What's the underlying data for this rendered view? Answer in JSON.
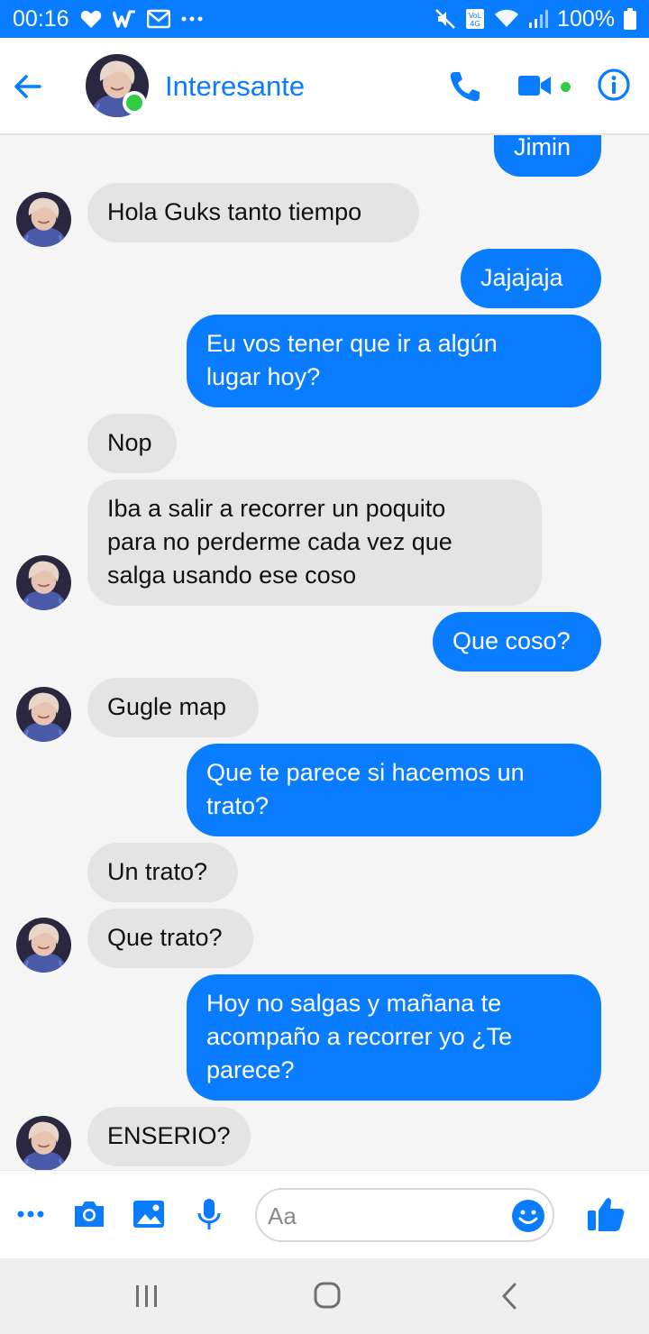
{
  "status_bar": {
    "time": "00:16",
    "battery": "100%",
    "left_icons": [
      "heart-icon",
      "w-app-icon",
      "gmail-icon",
      "more-icon"
    ],
    "right_icons": [
      "mute-icon",
      "volte-icon",
      "wifi-icon",
      "signal-icon",
      "battery-icon"
    ]
  },
  "header": {
    "title": "Interesante",
    "icons": [
      "back-arrow-icon",
      "phone-icon",
      "video-camera-icon",
      "info-icon"
    ],
    "online": true,
    "accent_color": "#0a7cff",
    "online_color": "#31cc46"
  },
  "messages": [
    {
      "side": "out",
      "text": "Jimin"
    },
    {
      "side": "in",
      "text": "Hola Guks tanto tiempo",
      "avatar": true
    },
    {
      "side": "out",
      "text": "Jajajaja"
    },
    {
      "side": "out",
      "text": "Eu vos tener que ir a algún\nlugar hoy?"
    },
    {
      "side": "in",
      "text": "Nop"
    },
    {
      "side": "in",
      "text": "Iba a salir a recorrer un poquito\npara no perderme cada vez que\nsalga usando ese coso",
      "avatar": true
    },
    {
      "side": "out",
      "text": "Que coso?"
    },
    {
      "side": "in",
      "text": "Gugle map",
      "avatar": true
    },
    {
      "side": "out",
      "text": "Que te parece si hacemos un\ntrato?"
    },
    {
      "side": "in",
      "text": "Un trato?"
    },
    {
      "side": "in",
      "text": "Que trato?",
      "avatar": true
    },
    {
      "side": "out",
      "text": "Hoy no salgas y mañana te\nacompaño a recorrer yo ¿Te\nparece?"
    },
    {
      "side": "in",
      "text": "ENSERIO?",
      "avatar": true
    }
  ],
  "composer": {
    "placeholder": "Aa",
    "value": "",
    "icons": [
      "more-dots-icon",
      "camera-icon",
      "image-icon",
      "microphone-icon",
      "emoji-icon",
      "thumbs-up-icon"
    ]
  },
  "nav_bar": {
    "icons": [
      "recents-icon",
      "home-icon",
      "back-icon"
    ]
  },
  "colors": {
    "outgoing_bubble": "#0a7cff",
    "incoming_bubble": "#e4e4e4",
    "background": "#f5f5f5"
  }
}
